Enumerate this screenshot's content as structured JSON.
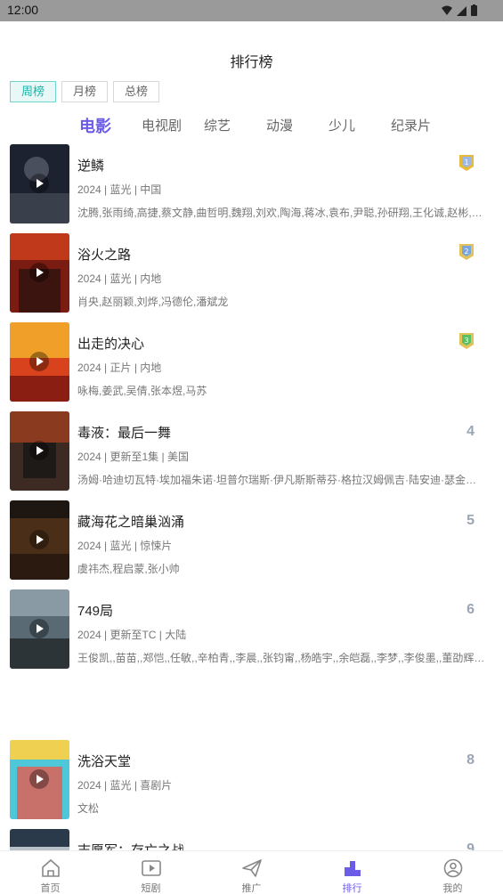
{
  "status_bar": {
    "time": "12:00"
  },
  "header": {
    "title": "排行榜"
  },
  "period_tabs": [
    {
      "label": "周榜",
      "active": true
    },
    {
      "label": "月榜",
      "active": false
    },
    {
      "label": "总榜",
      "active": false
    }
  ],
  "category_tabs": [
    {
      "label": "电影",
      "active": true
    },
    {
      "label": "电视剧",
      "active": false
    },
    {
      "label": "综艺",
      "active": false
    },
    {
      "label": "动漫",
      "active": false
    },
    {
      "label": "少儿",
      "active": false
    },
    {
      "label": "纪录片",
      "active": false
    }
  ],
  "rankings": [
    {
      "rank": "1",
      "title": "逆鳞",
      "meta": "2024 | 蓝光 | 中国",
      "cast": "沈腾,张雨绮,高捷,蔡文静,曲哲明,魏翔,刘欢,陶海,蒋冰,袁布,尹聪,孙研翔,王化诚,赵彬,…",
      "badge": "gold"
    },
    {
      "rank": "2",
      "title": "浴火之路",
      "meta": "2024 | 蓝光 | 内地",
      "cast": "肖央,赵丽颖,刘烨,冯德伦,潘斌龙",
      "badge": "silver"
    },
    {
      "rank": "3",
      "title": "出走的决心",
      "meta": "2024 | 正片 | 内地",
      "cast": "咏梅,姜武,吴倩,张本煜,马苏",
      "badge": "bronze"
    },
    {
      "rank": "4",
      "title": "毒液：最后一舞",
      "meta": "2024 | 更新至1集 | 美国",
      "cast": "汤姆·哈迪切瓦特·埃加福朱诺·坦普尔瑞斯·伊凡斯斯蒂芬·格拉汉姆佩吉·陆安迪·瑟金…",
      "badge": ""
    },
    {
      "rank": "5",
      "title": "藏海花之暗巢汹涌",
      "meta": "2024 | 蓝光 | 惊悚片",
      "cast": "虞祎杰,程启蒙,张小帅",
      "badge": ""
    },
    {
      "rank": "6",
      "title": "749局",
      "meta": "2024 | 更新至TC | 大陆",
      "cast": "王俊凯,,苗苗,,郑恺,,任敏,,辛柏青,,李晨,,张钧甯,,杨皓宇,,余皑磊,,李梦,,李俊墨,,董劭辉,…",
      "badge": ""
    },
    {
      "rank": "8",
      "title": "洗浴天堂",
      "meta": "2024 | 蓝光 | 喜剧片",
      "cast": "文松",
      "badge": ""
    },
    {
      "rank": "9",
      "title": "志愿军：存亡之战",
      "meta": "",
      "cast": "",
      "badge": ""
    }
  ],
  "bottom_nav": [
    {
      "label": "首页",
      "icon": "home-icon",
      "active": false
    },
    {
      "label": "短剧",
      "icon": "video-icon",
      "active": false
    },
    {
      "label": "推广",
      "icon": "send-icon",
      "active": false
    },
    {
      "label": "排行",
      "icon": "ranking-icon",
      "active": true
    },
    {
      "label": "我的",
      "icon": "profile-icon",
      "active": false
    }
  ],
  "colors": {
    "accent": "#6c5ce7",
    "period_active": "#1eb3a8",
    "rank_number": "#9aa6b6",
    "badge_gold": "#e8b93a",
    "badge_silver": "#7aa6e0",
    "badge_bronze": "#5bbf64"
  }
}
